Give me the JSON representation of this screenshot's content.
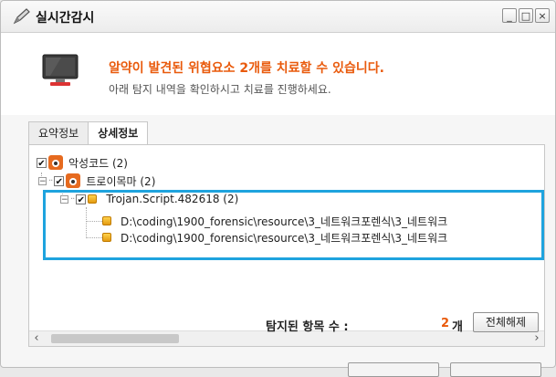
{
  "window": {
    "title": "실시간감시"
  },
  "window_buttons": {
    "minimize": "_",
    "maximize": "□",
    "close": "×"
  },
  "header": {
    "warning": "알약이 발견된 위협요소 2개를 치료할 수 있습니다.",
    "subtext": "아래 탐지 내역을 확인하시고 치료를 진행하세요."
  },
  "tabs": [
    {
      "label": "요약정보",
      "active": false
    },
    {
      "label": "상세정보",
      "active": true
    }
  ],
  "tree": {
    "root": {
      "label": "악성코드 (2)",
      "checked": true
    },
    "category": {
      "label": "트로이목마 (2)",
      "checked": true
    },
    "threat": {
      "label": "Trojan.Script.482618 (2)",
      "checked": true
    },
    "files": [
      "D:\\coding\\1900_forensic\\resource\\3_네트워크포렌식\\3_네트워크",
      "D:\\coding\\1900_forensic\\resource\\3_네트워크포렌식\\3_네트워크"
    ]
  },
  "scrollbar": {
    "left_arrow": "‹",
    "right_arrow": "›"
  },
  "summary": {
    "label": "탐지된 항목 수 :",
    "count": "2",
    "unit": "개",
    "release_all": "전체해제"
  },
  "colors": {
    "warning": "#e95a0c",
    "highlight": "#1ea3de"
  },
  "icons": {
    "title": "check-pencil-icon",
    "monitor": "monitor-icon",
    "malware": "bug-icon",
    "threat": "orange-square-icon"
  }
}
